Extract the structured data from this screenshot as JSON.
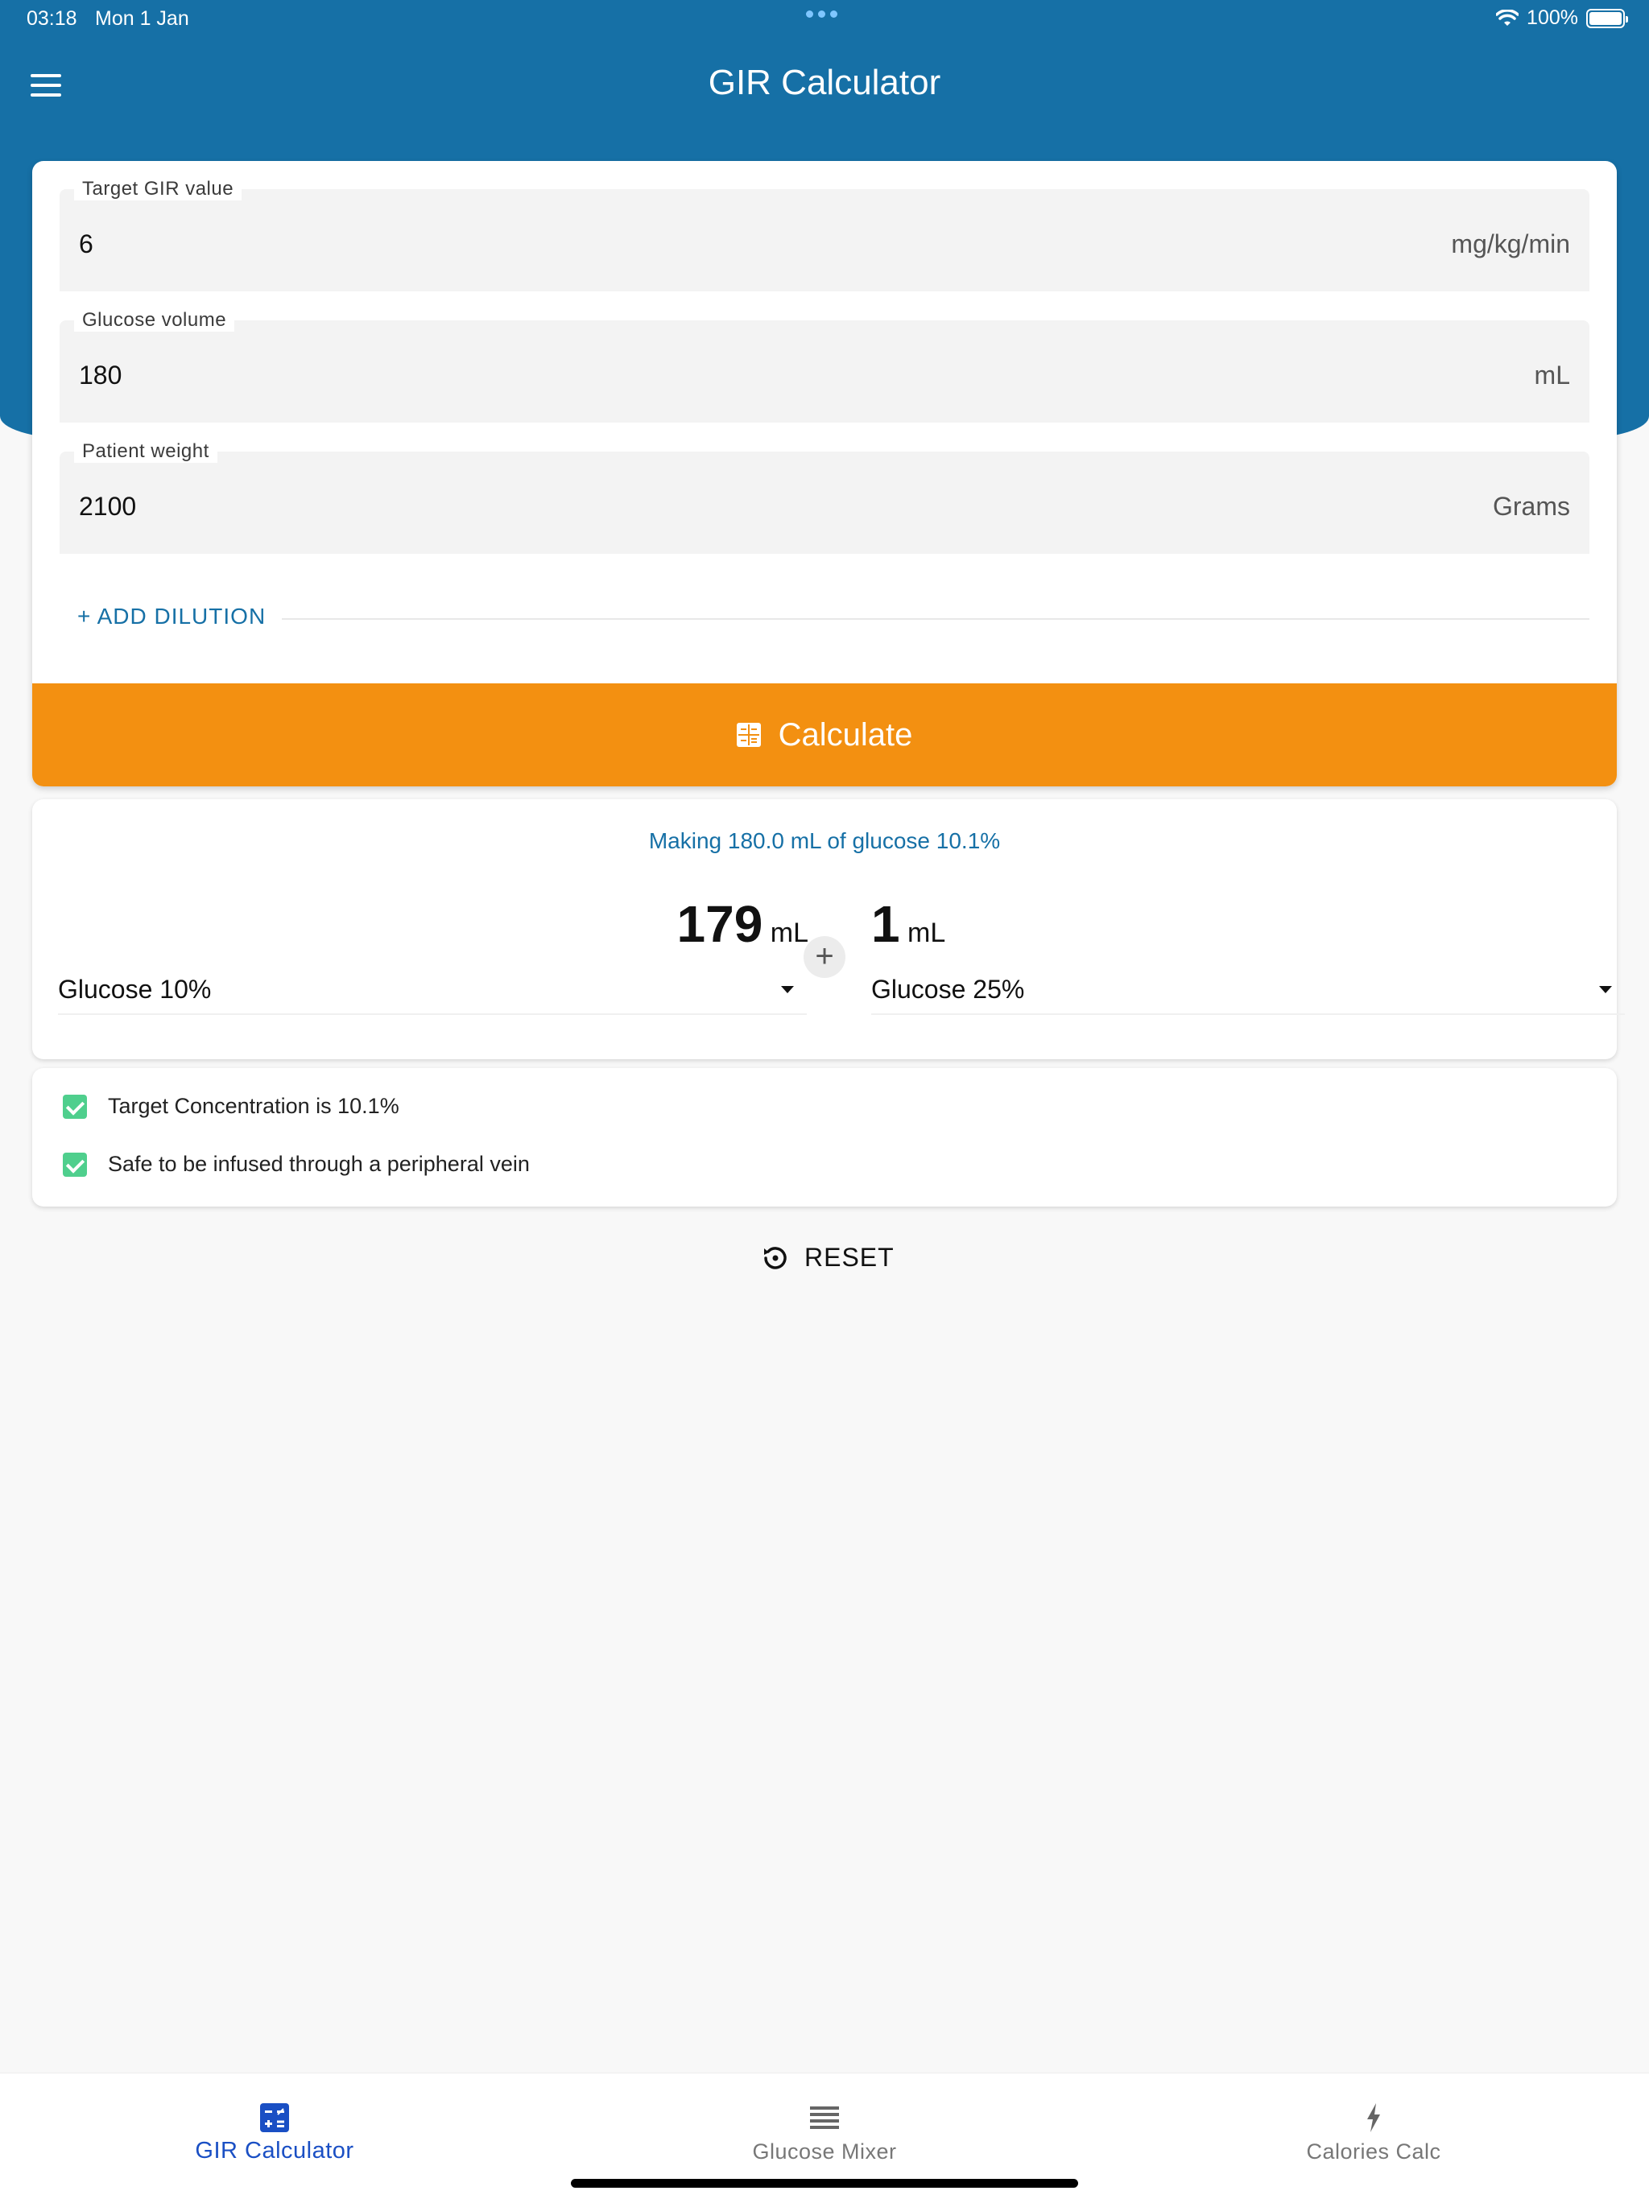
{
  "status_bar": {
    "time": "03:18",
    "date": "Mon 1 Jan",
    "battery": "100%"
  },
  "header": {
    "title": "GIR Calculator",
    "menu_icon": "hamburger-menu-icon"
  },
  "form": {
    "fields": [
      {
        "label": "Target GIR value",
        "value": "6",
        "unit": "mg/kg/min"
      },
      {
        "label": "Glucose volume",
        "value": "180",
        "unit": "mL"
      },
      {
        "label": "Patient weight",
        "value": "2100",
        "unit": "Grams"
      }
    ],
    "add_dilution_label": "+ ADD DILUTION",
    "calculate_label": "Calculate"
  },
  "result": {
    "title": "Making 180.0 mL of glucose 10.1%",
    "left": {
      "amount": "179",
      "unit": "mL",
      "solution": "Glucose 10%"
    },
    "right": {
      "amount": "1",
      "unit": "mL",
      "solution": "Glucose 25%"
    },
    "plus_symbol": "+"
  },
  "checks": [
    {
      "label": "Target Concentration is 10.1%",
      "checked": true
    },
    {
      "label": "Safe to be infused through a peripheral vein",
      "checked": true
    }
  ],
  "reset_label": "RESET",
  "bottom_nav": [
    {
      "label": "GIR Calculator",
      "icon": "calculator-icon",
      "active": true
    },
    {
      "label": "Glucose Mixer",
      "icon": "list-icon",
      "active": false
    },
    {
      "label": "Calories Calc",
      "icon": "bolt-icon",
      "active": false
    }
  ],
  "colors": {
    "header": "#1670a6",
    "accent_orange": "#f39011",
    "check_green": "#4fcf8d",
    "nav_active": "#1a4fc4"
  }
}
